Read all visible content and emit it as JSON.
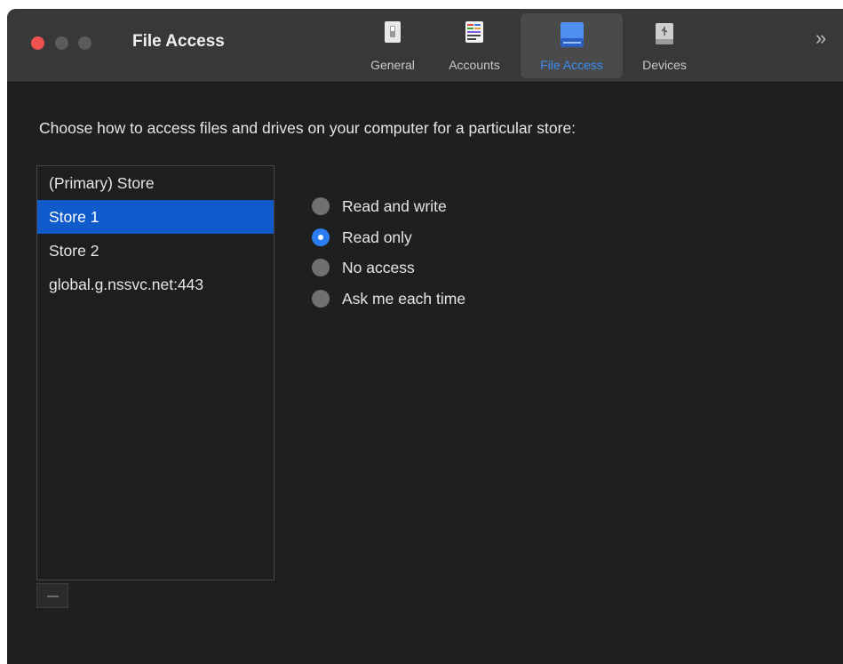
{
  "window": {
    "title": "File Access"
  },
  "toolbar": {
    "items": [
      {
        "label": "General",
        "icon": "general-switch-icon"
      },
      {
        "label": "Accounts",
        "icon": "accounts-icon"
      },
      {
        "label": "File Access",
        "icon": "hard-drive-icon",
        "selected": true
      },
      {
        "label": "Devices",
        "icon": "usb-drive-icon"
      }
    ],
    "more": "»"
  },
  "main": {
    "prompt": "Choose how to access files and drives on your computer for a particular store:",
    "stores": [
      {
        "label": "(Primary) Store"
      },
      {
        "label": "Store 1",
        "selected": true
      },
      {
        "label": "Store 2"
      },
      {
        "label": "global.g.nssvc.net:443"
      }
    ],
    "options": [
      {
        "label": "Read and write",
        "checked": false
      },
      {
        "label": "Read only",
        "checked": true
      },
      {
        "label": "No access",
        "checked": false
      },
      {
        "label": "Ask me each time",
        "checked": false
      }
    ]
  },
  "colors": {
    "accent": "#2a7ef2",
    "selection": "#0f5bcc",
    "close_button": "#f0524f"
  }
}
